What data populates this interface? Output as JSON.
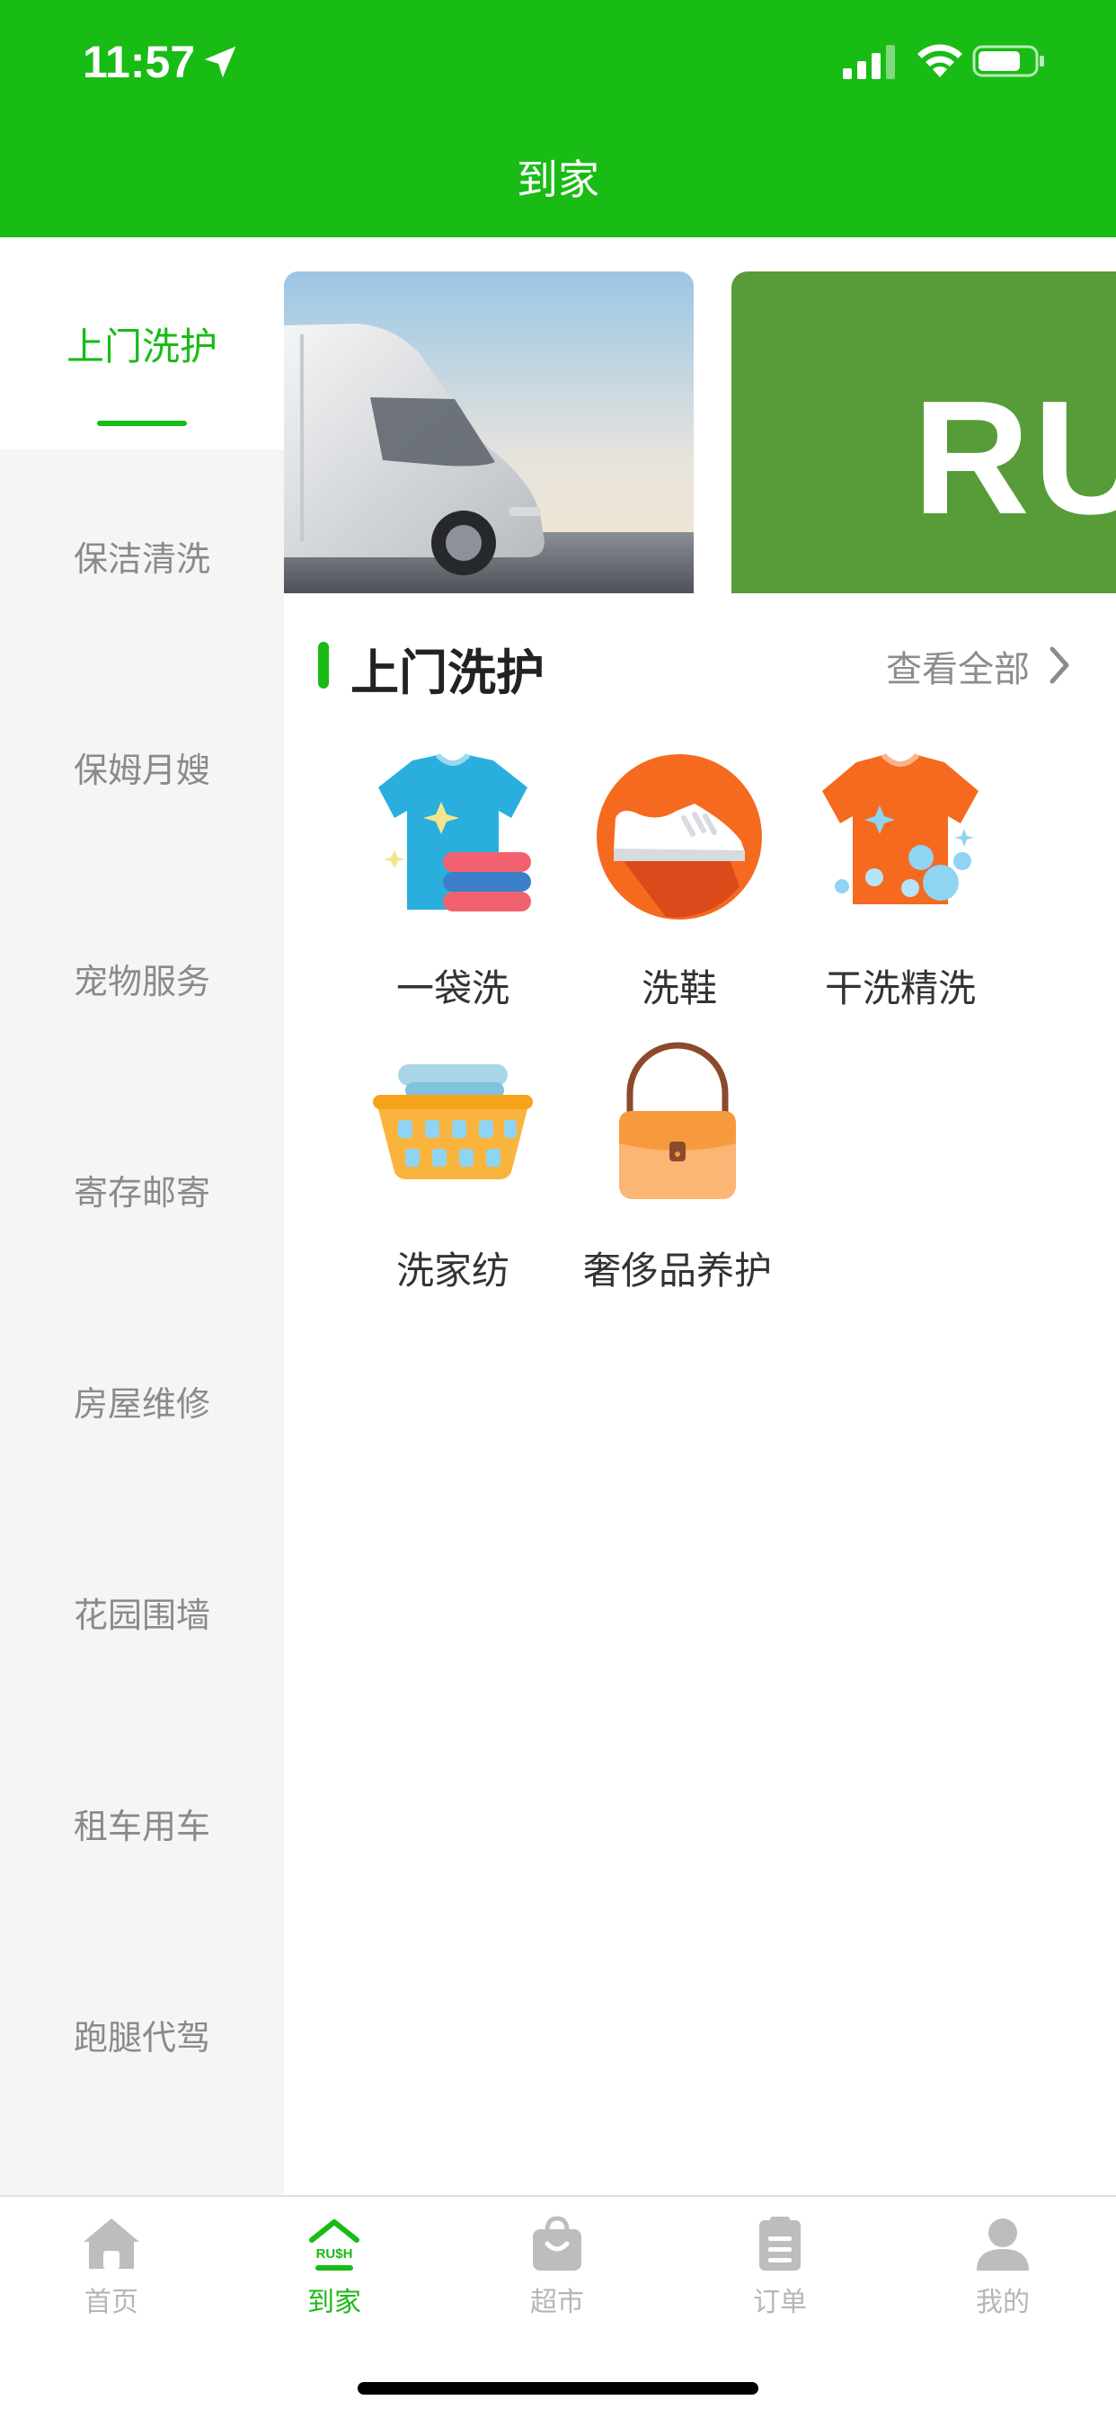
{
  "status_bar": {
    "time": "11:57"
  },
  "header": {
    "title": "到家"
  },
  "sidebar": {
    "items": [
      {
        "label": "上门洗护"
      },
      {
        "label": "保洁清洗"
      },
      {
        "label": "保姆月嫂"
      },
      {
        "label": "宠物服务"
      },
      {
        "label": "寄存邮寄"
      },
      {
        "label": "房屋维修"
      },
      {
        "label": "花园围墙"
      },
      {
        "label": "租车用车"
      },
      {
        "label": "跑腿代驾"
      }
    ]
  },
  "banners": {
    "second_text": "RU"
  },
  "section": {
    "title": "上门洗护",
    "more": "查看全部"
  },
  "services": [
    {
      "label": "一袋洗",
      "icon": "tshirt-stack-icon"
    },
    {
      "label": "洗鞋",
      "icon": "shoe-icon"
    },
    {
      "label": "干洗精洗",
      "icon": "tshirt-bubbles-icon"
    },
    {
      "label": "洗家纺",
      "icon": "laundry-basket-icon"
    },
    {
      "label": "奢侈品养护",
      "icon": "handbag-icon"
    }
  ],
  "tabbar": {
    "tabs": [
      {
        "label": "首页",
        "icon": "home-icon"
      },
      {
        "label": "到家",
        "icon": "rush-home-icon"
      },
      {
        "label": "超市",
        "icon": "shopping-bag-icon"
      },
      {
        "label": "订单",
        "icon": "order-icon"
      },
      {
        "label": "我的",
        "icon": "user-icon"
      }
    ],
    "rush_icon_text": "RU$H"
  },
  "colors": {
    "brand": "#19bb15",
    "sidebar_bg": "#f5f5f5",
    "inactive": "#b6b6b6"
  }
}
